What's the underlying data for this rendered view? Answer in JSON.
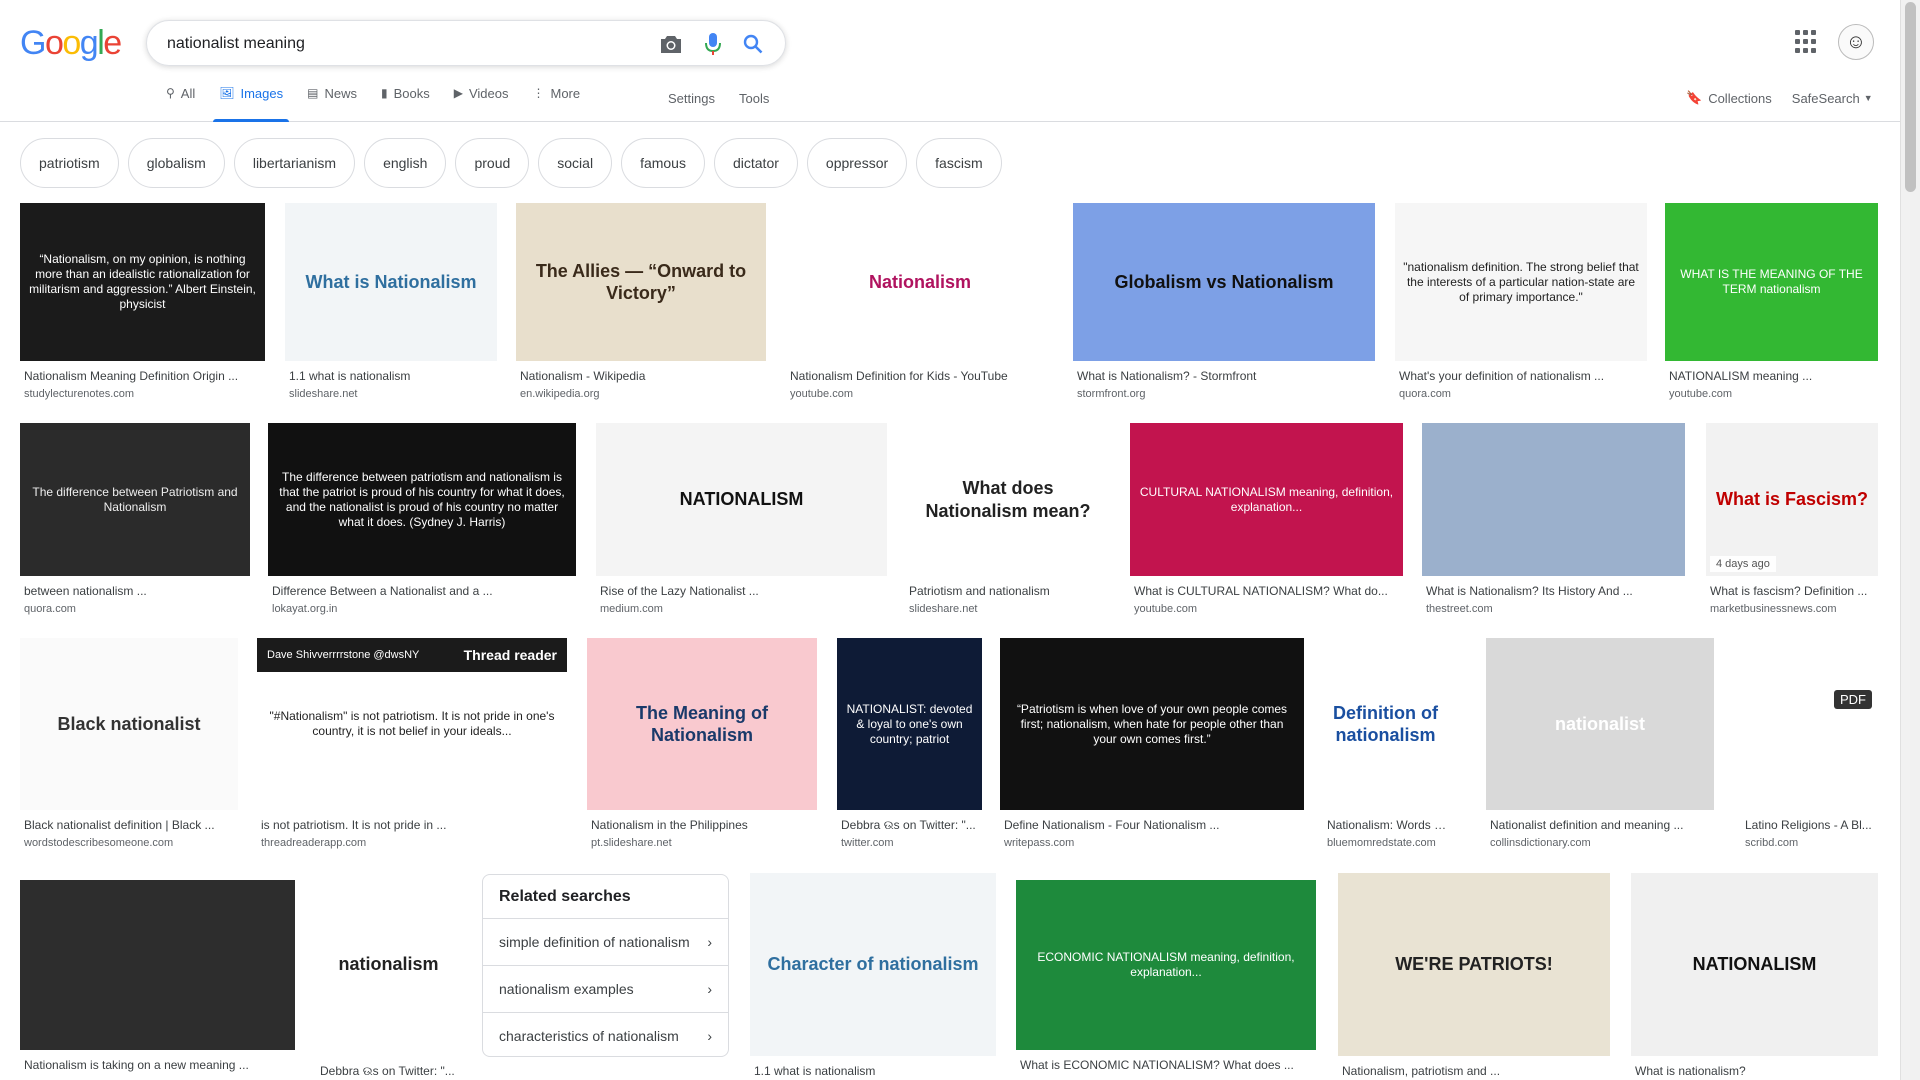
{
  "colors": {
    "accent": "#1a73e8",
    "chip_border": "#dadce0",
    "text_secondary": "#5f6368"
  },
  "logo": {
    "letters": [
      "G",
      "o",
      "o",
      "g",
      "l",
      "e"
    ],
    "colors": [
      "#4285f4",
      "#ea4335",
      "#fbbc05",
      "#4285f4",
      "#34a853",
      "#ea4335"
    ]
  },
  "search": {
    "query": "nationalist meaning"
  },
  "icons": {
    "camera": "camera-icon",
    "mic": "microphone-icon",
    "search": "search-icon",
    "apps": "apps-grid-icon"
  },
  "tabs": [
    {
      "label": "All",
      "icon": "magnifier"
    },
    {
      "label": "Images",
      "icon": "image"
    },
    {
      "label": "News",
      "icon": "newspaper"
    },
    {
      "label": "Books",
      "icon": "book"
    },
    {
      "label": "Videos",
      "icon": "play"
    },
    {
      "label": "More",
      "icon": "more-vertical"
    }
  ],
  "tools": {
    "settings": "Settings",
    "tools": "Tools"
  },
  "header_right": {
    "collections": "Collections",
    "safesearch": "SafeSearch"
  },
  "chips": [
    "patriotism",
    "globalism",
    "libertarianism",
    "english",
    "proud",
    "social",
    "famous",
    "dictator",
    "oppressor",
    "fascism"
  ],
  "results": [
    {
      "title": "Nationalism Meaning Definition Origin ...",
      "source": "studylecturenotes.com",
      "thumb_text": "“Nationalism, on my opinion, is nothing more than an idealistic rationalization for militarism and aggression.”  Albert Einstein, physicist",
      "bg": "#1b1b1b",
      "fg": "#ffffff"
    },
    {
      "title": "1.1 what is nationalism",
      "source": "slideshare.net",
      "thumb_text": "What is Nationalism",
      "bg": "#f2f5f7",
      "fg": "#2f6f9f"
    },
    {
      "title": "Nationalism - Wikipedia",
      "source": "en.wikipedia.org",
      "thumb_text": "The Allies — “Onward to Victory”",
      "bg": "#e8dfcc",
      "fg": "#3a2a1a"
    },
    {
      "title": "Nationalism Definition for Kids - YouTube",
      "source": "youtube.com",
      "thumb_text": "Nationalism",
      "bg": "#ffffff",
      "fg": "#b0135f"
    },
    {
      "title": "What is Nationalism? - Stormfront",
      "source": "stormfront.org",
      "thumb_text": "Globalism  vs  Nationalism",
      "bg": "#7da0e6",
      "fg": "#111111"
    },
    {
      "title": "What's your definition of nationalism ...",
      "source": "quora.com",
      "thumb_text": "\"nationalism definition. The strong belief that the interests of a particular nation-state are of primary importance.\"",
      "bg": "#f6f6f6",
      "fg": "#222222"
    },
    {
      "title": "NATIONALISM meaning ...",
      "source": "youtube.com",
      "thumb_text": "WHAT IS THE MEANING OF THE TERM nationalism",
      "bg": "#33b833",
      "fg": "#ffffff"
    },
    {
      "title": "between nationalism ...",
      "source": "quora.com",
      "thumb_text": "The difference between Patriotism and Nationalism",
      "bg": "#2b2b2b",
      "fg": "#eeeeee"
    },
    {
      "title": "Difference Between a Nationalist and a ...",
      "source": "lokayat.org.in",
      "thumb_text": "The difference between patriotism and nationalism is that the patriot is proud of his country for what it does, and the nationalist is proud of his country no matter what it does. (Sydney J. Harris)",
      "bg": "#111111",
      "fg": "#ffffff"
    },
    {
      "title": "Rise of the Lazy Nationalist ...",
      "source": "medium.com",
      "thumb_text": "NATIONALISM",
      "bg": "#f4f4f4",
      "fg": "#111111"
    },
    {
      "title": "Patriotism and nationalism",
      "source": "slideshare.net",
      "thumb_text": "What does Nationalism mean?",
      "bg": "#ffffff",
      "fg": "#222222"
    },
    {
      "title": "What is CULTURAL NATIONALISM? What do...",
      "source": "youtube.com",
      "thumb_text": "CULTURAL NATIONALISM  meaning, definition, explanation...",
      "bg": "#c2144e",
      "fg": "#ffffff"
    },
    {
      "title": "What is Nationalism? Its History And ...",
      "source": "thestreet.com",
      "thumb_text": "",
      "bg": "#9bb0cc",
      "fg": "#ffffff"
    },
    {
      "title": "What is fascism? Definition ...",
      "source": "marketbusinessnews.com",
      "thumb_text": "What is Fascism?",
      "bg": "#f2f2f2",
      "fg": "#c00000",
      "badge": "4 days ago"
    },
    {
      "title": "Black nationalist definition | Black ...",
      "source": "wordstodescribesomeone.com",
      "thumb_text": "Black nationalist",
      "bg": "#fafafa",
      "fg": "#333333"
    },
    {
      "title": "is not patriotism. It is not pride in ...",
      "source": "threadreaderapp.com",
      "thumb_text": "\"#Nationalism\" is not patriotism. It is not pride in one's country, it is not belief in your ideals...",
      "bg": "#ffffff",
      "fg": "#222222",
      "header_user": "Dave Shivverrrrstone @dwsNY",
      "header_label": "Thread reader"
    },
    {
      "title": "Nationalism in the Philippines",
      "source": "pt.slideshare.net",
      "thumb_text": "The Meaning of Nationalism",
      "bg": "#f9c9cf",
      "fg": "#1a3a6a"
    },
    {
      "title": "Debbra ଉs on Twitter: \"...",
      "source": "twitter.com",
      "thumb_text": "NATIONALIST: devoted & loyal to one's own country; patriot",
      "bg": "#0e1b36",
      "fg": "#ffffff"
    },
    {
      "title": "Define Nationalism - Four Nationalism ...",
      "source": "writepass.com",
      "thumb_text": "“Patriotism is when love of your own people comes first; nationalism, when hate for people other than your own comes first.”",
      "bg": "#111111",
      "fg": "#ffffff"
    },
    {
      "title": "Nationalism: Words M...",
      "source": "bluemomredstate.com",
      "thumb_text": "Definition of nationalism",
      "bg": "#ffffff",
      "fg": "#1a4fa0"
    },
    {
      "title": "Nationalist definition and meaning ...",
      "source": "collinsdictionary.com",
      "thumb_text": "nationalist",
      "bg": "#d9d9d9",
      "fg": "#ffffff"
    },
    {
      "title": "Latino Religions - A Bl...",
      "source": "scribd.com",
      "thumb_text": "",
      "bg": "#ffffff",
      "fg": "#222222",
      "badge": "PDF"
    },
    {
      "title": "Nationalism is taking on a new meaning ...",
      "source": "",
      "thumb_text": "",
      "bg": "#2d2d2d",
      "fg": "#ffffff"
    },
    {
      "title": "Debbra ଉs on Twitter: \"...",
      "source": "",
      "thumb_text": "nationalism",
      "bg": "#ffffff",
      "fg": "#222222"
    },
    {
      "title": "1.1 what is nationalism",
      "source": "",
      "thumb_text": "Character of nationalism",
      "bg": "#f2f5f7",
      "fg": "#2f6f9f"
    },
    {
      "title": "What is ECONOMIC NATIONALISM? What does ...",
      "source": "",
      "thumb_text": "ECONOMIC NATIONALISM  meaning, definition, explanation...",
      "bg": "#1e8a3c",
      "fg": "#ffffff"
    },
    {
      "title": "Nationalism, patriotism and ...",
      "source": "",
      "thumb_text": "WE'RE PATRIOTS!",
      "bg": "#e9e3d3",
      "fg": "#222222"
    },
    {
      "title": "What is nationalism?",
      "source": "",
      "thumb_text": "NATIONALISM",
      "bg": "#f0f0f0",
      "fg": "#111111"
    }
  ],
  "related": {
    "heading": "Related searches",
    "items": [
      "simple definition of nationalism",
      "nationalism examples",
      "characteristics of nationalism"
    ]
  }
}
